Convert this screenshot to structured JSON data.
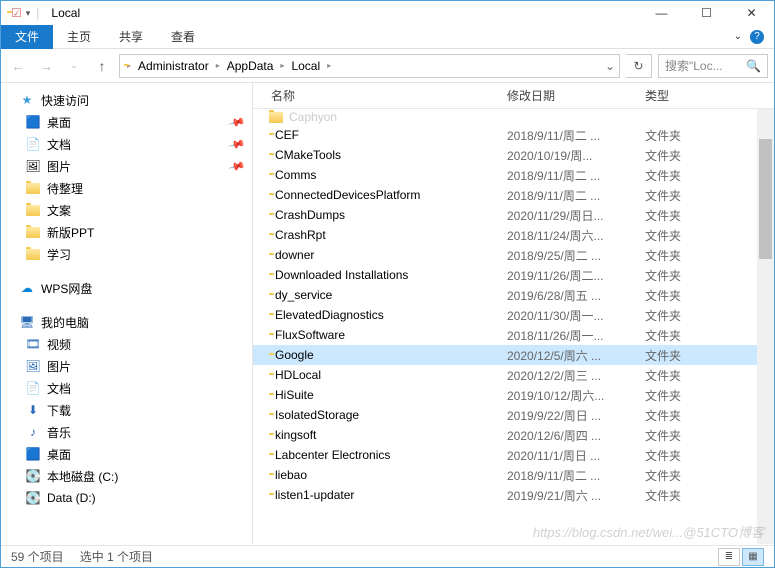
{
  "window": {
    "title": "Local",
    "controls": {
      "min": "—",
      "max": "☐",
      "close": "✕"
    }
  },
  "ribbon": {
    "file": "文件",
    "tabs": [
      "主页",
      "共享",
      "查看"
    ]
  },
  "breadcrumbs": [
    "Administrator",
    "AppData",
    "Local"
  ],
  "search": {
    "placeholder": "搜索\"Loc..."
  },
  "sidebar": {
    "quick": "快速访问",
    "items": [
      {
        "label": "桌面",
        "icon": "desktop",
        "pin": true
      },
      {
        "label": "文档",
        "icon": "doc",
        "pin": true
      },
      {
        "label": "图片",
        "icon": "pic",
        "pin": true
      },
      {
        "label": "待整理",
        "icon": "folder",
        "pin": false
      },
      {
        "label": "文案",
        "icon": "folder",
        "pin": false
      },
      {
        "label": "新版PPT",
        "icon": "folder",
        "pin": false
      },
      {
        "label": "学习",
        "icon": "folder",
        "pin": false
      }
    ],
    "wps": "WPS网盘",
    "thispc": "我的电脑",
    "pc_items": [
      {
        "label": "视频",
        "icon": "video"
      },
      {
        "label": "图片",
        "icon": "pic"
      },
      {
        "label": "文档",
        "icon": "doc"
      },
      {
        "label": "下载",
        "icon": "download"
      },
      {
        "label": "音乐",
        "icon": "music"
      },
      {
        "label": "桌面",
        "icon": "desktop"
      },
      {
        "label": "本地磁盘 (C:)",
        "icon": "disk"
      },
      {
        "label": "Data (D:)",
        "icon": "disk"
      }
    ]
  },
  "columns": {
    "name": "名称",
    "date": "修改日期",
    "type": "类型"
  },
  "truncated_top": "Caphyon",
  "files": [
    {
      "name": "CEF",
      "date": "2018/9/11/周二 ...",
      "type": "文件夹"
    },
    {
      "name": "CMakeTools",
      "date": "2020/10/19/周...",
      "type": "文件夹"
    },
    {
      "name": "Comms",
      "date": "2018/9/11/周二 ...",
      "type": "文件夹"
    },
    {
      "name": "ConnectedDevicesPlatform",
      "date": "2018/9/11/周二 ...",
      "type": "文件夹"
    },
    {
      "name": "CrashDumps",
      "date": "2020/11/29/周日...",
      "type": "文件夹"
    },
    {
      "name": "CrashRpt",
      "date": "2018/11/24/周六...",
      "type": "文件夹"
    },
    {
      "name": "downer",
      "date": "2018/9/25/周二 ...",
      "type": "文件夹"
    },
    {
      "name": "Downloaded Installations",
      "date": "2019/11/26/周二...",
      "type": "文件夹"
    },
    {
      "name": "dy_service",
      "date": "2019/6/28/周五 ...",
      "type": "文件夹"
    },
    {
      "name": "ElevatedDiagnostics",
      "date": "2020/11/30/周一...",
      "type": "文件夹"
    },
    {
      "name": "FluxSoftware",
      "date": "2018/11/26/周一...",
      "type": "文件夹"
    },
    {
      "name": "Google",
      "date": "2020/12/5/周六 ...",
      "type": "文件夹",
      "selected": true
    },
    {
      "name": "HDLocal",
      "date": "2020/12/2/周三 ...",
      "type": "文件夹"
    },
    {
      "name": "HiSuite",
      "date": "2019/10/12/周六...",
      "type": "文件夹"
    },
    {
      "name": "IsolatedStorage",
      "date": "2019/9/22/周日 ...",
      "type": "文件夹"
    },
    {
      "name": "kingsoft",
      "date": "2020/12/6/周四 ...",
      "type": "文件夹"
    },
    {
      "name": "Labcenter Electronics",
      "date": "2020/11/1/周日 ...",
      "type": "文件夹"
    },
    {
      "name": "liebao",
      "date": "2018/9/11/周二 ...",
      "type": "文件夹"
    },
    {
      "name": "listen1-updater",
      "date": "2019/9/21/周六 ...",
      "type": "文件夹"
    }
  ],
  "status": {
    "count": "59 个项目",
    "selected": "选中 1 个项目"
  },
  "watermark": "https://blog.csdn.net/wei...@51CTO博客"
}
